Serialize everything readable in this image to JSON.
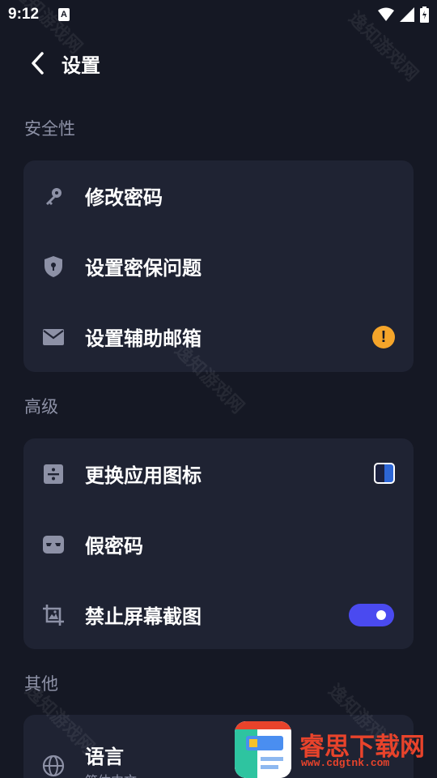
{
  "status_bar": {
    "time": "9:12",
    "notification_badge": "A"
  },
  "header": {
    "title": "设置"
  },
  "sections": {
    "security": {
      "title": "安全性",
      "items": [
        {
          "label": "修改密码",
          "icon": "key-icon"
        },
        {
          "label": "设置密保问题",
          "icon": "shield-icon"
        },
        {
          "label": "设置辅助邮箱",
          "icon": "mail-icon",
          "badge": "!",
          "badge_color": "#f5a52a"
        }
      ]
    },
    "advanced": {
      "title": "高级",
      "items": [
        {
          "label": "更换应用图标",
          "icon": "divide-icon"
        },
        {
          "label": "假密码",
          "icon": "mask-icon"
        },
        {
          "label": "禁止屏幕截图",
          "icon": "screenshot-icon",
          "toggle_on": true,
          "toggle_color": "#4a4af0"
        }
      ]
    },
    "other": {
      "title": "其他",
      "items": [
        {
          "label": "语言",
          "sub": "简体中文",
          "icon": "globe-icon"
        }
      ]
    }
  },
  "watermark": {
    "text": "逸知游戏网",
    "logo_text": "睿思下载网",
    "logo_url": "www.cdgtnk.com"
  },
  "colors": {
    "background": "#151824",
    "card": "#1f2333",
    "section_title": "#8d91a6",
    "icon": "#8d91a6",
    "accent": "#4a4af0",
    "warning": "#f5a52a"
  }
}
